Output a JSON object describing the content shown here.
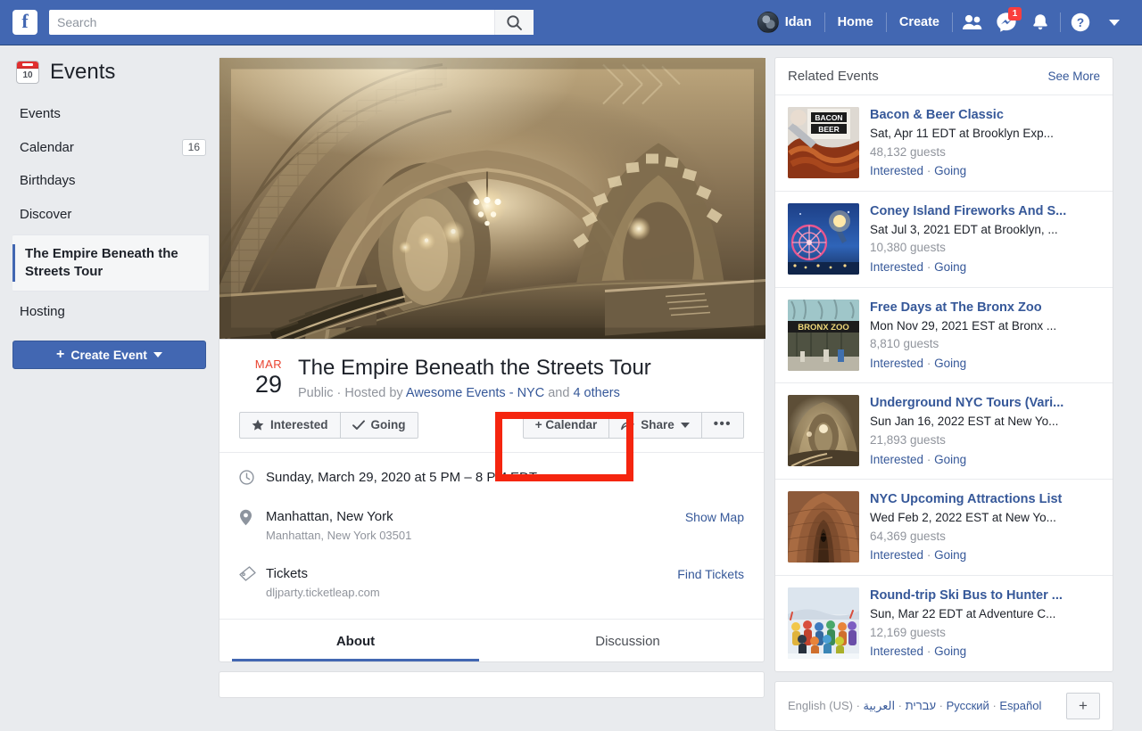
{
  "topbar": {
    "logo": "f",
    "search": {
      "value": "",
      "placeholder": "Search"
    },
    "search_icon": "search-icon",
    "user_name": "Idan",
    "home_label": "Home",
    "create_label": "Create",
    "friend_requests_icon": "friends-icon",
    "messages_icon": "messenger-icon",
    "messages_badge": "1",
    "notifications_icon": "bell-icon",
    "help_icon": "help-icon",
    "account_menu_icon": "chevron-down-icon",
    "brand_color": "#4267B2"
  },
  "sidebar": {
    "title": "Events",
    "icon_day": "10",
    "items": [
      {
        "label": "Events",
        "badge": ""
      },
      {
        "label": "Calendar",
        "badge": "16"
      },
      {
        "label": "Birthdays",
        "badge": ""
      },
      {
        "label": "Discover",
        "badge": ""
      }
    ],
    "active_item": "The Empire Beneath the Streets Tour",
    "hosting_label": "Hosting",
    "create_event_label": "Create Event"
  },
  "event": {
    "cover_alt": "Historic City Hall subway station vaulted tiled arches in sepia",
    "date_month": "MAR",
    "date_day": "29",
    "title": "The Empire Beneath the Streets Tour",
    "privacy": "Public",
    "hosted_by_prefix": "Hosted by",
    "host_name": "Awesome Events - NYC",
    "and_text": "and",
    "others_link": "4 others",
    "buttons": {
      "interested": "Interested",
      "going": "Going",
      "calendar": "+ Calendar",
      "share": "Share",
      "more": "•••"
    },
    "info": {
      "datetime": "Sunday, March 29, 2020 at 5 PM – 8 PM EDT",
      "location_name": "Manhattan, New York",
      "location_address": "Manhattan, New York 03501",
      "show_map": "Show Map",
      "tickets_label": "Tickets",
      "tickets_url": "dljparty.ticketleap.com",
      "find_tickets": "Find Tickets"
    },
    "tabs": [
      {
        "label": "About",
        "active": true
      },
      {
        "label": "Discussion",
        "active": false
      }
    ]
  },
  "annotation": {
    "target": "+ Calendar",
    "color": "#f5250f"
  },
  "related": {
    "title": "Related Events",
    "see_more": "See More",
    "interested_label": "Interested",
    "going_label": "Going",
    "items": [
      {
        "name": "Bacon & Beer Classic",
        "when": "Sat, Apr 11 EDT at Brooklyn Exp...",
        "guests": "48,132 guests",
        "thumb": "bacon-beer"
      },
      {
        "name": "Coney Island Fireworks And S...",
        "when": "Sat Jul 3, 2021 EDT at Brooklyn, ...",
        "guests": "10,380 guests",
        "thumb": "ferris-wheel"
      },
      {
        "name": "Free Days at The Bronx Zoo",
        "when": "Mon Nov 29, 2021 EST at Bronx ...",
        "guests": "8,810 guests",
        "thumb": "bronx-zoo"
      },
      {
        "name": "Underground NYC Tours (Vari...",
        "when": "Sun Jan 16, 2022 EST at New Yo...",
        "guests": "21,893 guests",
        "thumb": "subway-arch"
      },
      {
        "name": "NYC Upcoming Attractions List",
        "when": "Wed Feb 2, 2022 EST at New Yo...",
        "guests": "64,369 guests",
        "thumb": "brick-tunnel"
      },
      {
        "name": "Round-trip Ski Bus to Hunter ...",
        "when": "Sun, Mar 22 EDT at Adventure C...",
        "guests": "12,169 guests",
        "thumb": "ski-group"
      }
    ]
  },
  "footer": {
    "current_language": "English (US)",
    "languages": [
      "עברית",
      "العربية",
      "Русский",
      "Español"
    ],
    "add_language": "+"
  }
}
